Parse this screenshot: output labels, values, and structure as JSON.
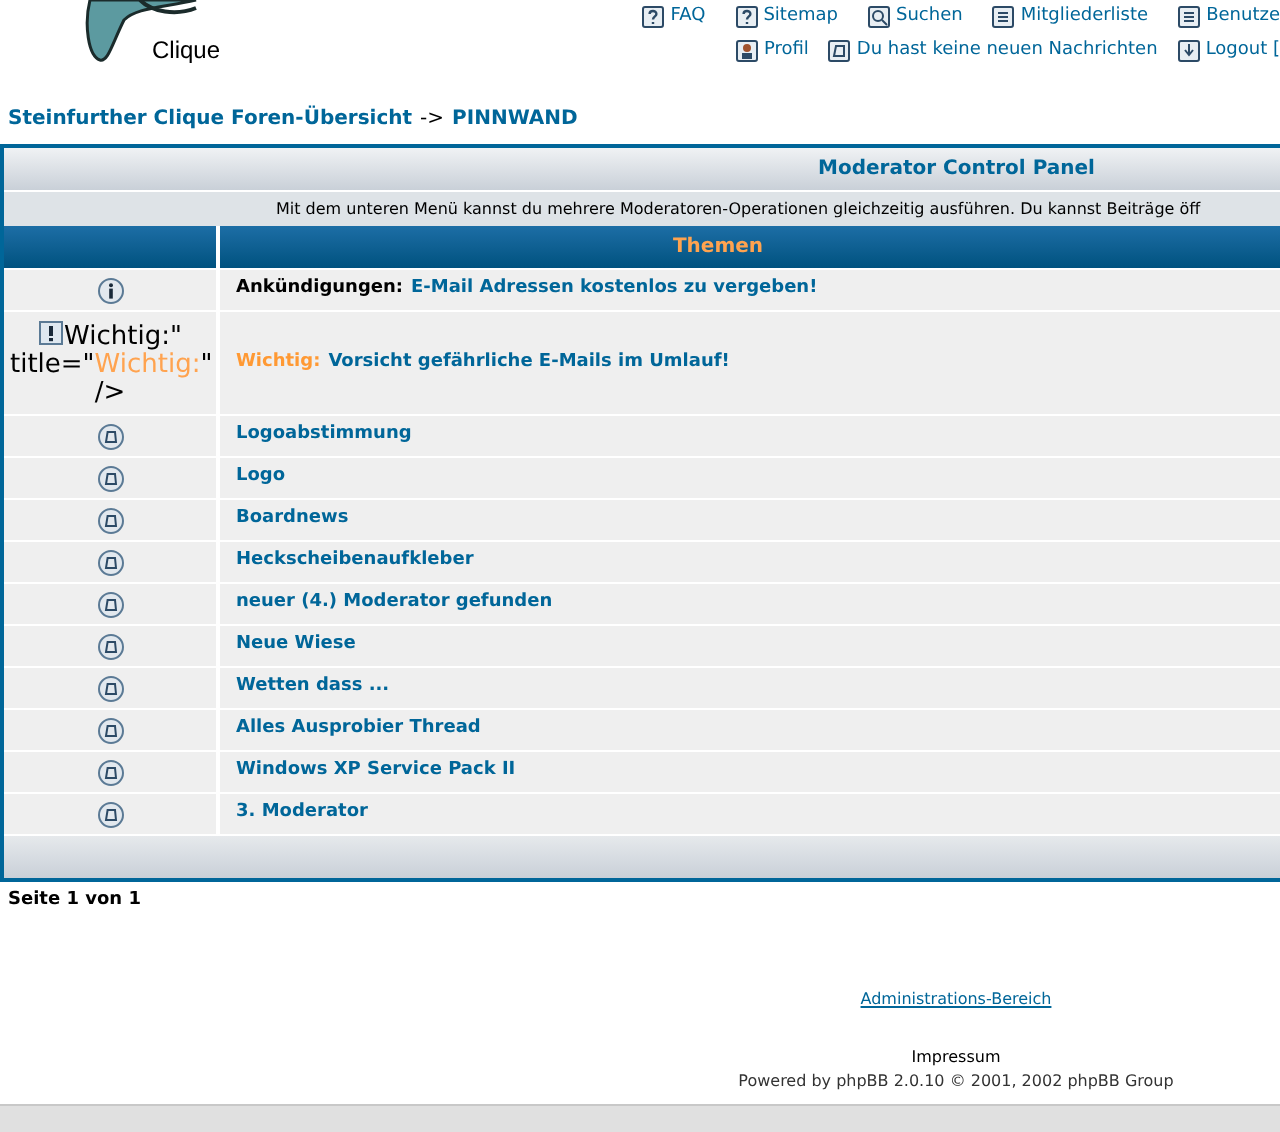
{
  "logo": {
    "text": "Clique"
  },
  "nav_top": [
    {
      "label": "FAQ"
    },
    {
      "label": "Sitemap"
    },
    {
      "label": "Suchen"
    },
    {
      "label": "Mitgliederliste"
    },
    {
      "label": "Benutze"
    }
  ],
  "nav_bottom": [
    {
      "label": "Profil"
    },
    {
      "label": "Du hast keine neuen Nachrichten"
    },
    {
      "label": "Logout ["
    }
  ],
  "breadcrumb": {
    "home": "Steinfurther Clique Foren-Übersicht",
    "separator": "->",
    "current": "PINNWAND"
  },
  "panel": {
    "title": "Moderator Control Panel",
    "description": "Mit dem unteren Menü kannst du mehrere Moderatoren-Operationen gleichzeitig ausführen. Du kannst Beiträge öff"
  },
  "table": {
    "columns": [
      "Themen"
    ],
    "rows": [
      {
        "kind": "announcement",
        "prefix": "Ankündigungen:",
        "title": "E-Mail Adressen kostenlos zu vergeben!"
      },
      {
        "kind": "sticky",
        "alt_text": [
          "Wichtig:\" title=\"",
          "Wichtig:",
          "\" />"
        ],
        "prefix": "Wichtig:",
        "title": "Vorsicht gefährliche E-Mails im Umlauf!"
      },
      {
        "kind": "normal",
        "title": "Logoabstimmung"
      },
      {
        "kind": "normal",
        "title": "Logo"
      },
      {
        "kind": "normal",
        "title": "Boardnews"
      },
      {
        "kind": "normal",
        "title": "Heckscheibenaufkleber"
      },
      {
        "kind": "normal",
        "title": "neuer (4.) Moderator gefunden"
      },
      {
        "kind": "normal",
        "title": "Neue Wiese"
      },
      {
        "kind": "normal",
        "title": "Wetten dass ..."
      },
      {
        "kind": "normal",
        "title": "Alles Ausprobier Thread"
      },
      {
        "kind": "normal",
        "title": "Windows XP Service Pack II"
      },
      {
        "kind": "normal",
        "title": "3. Moderator"
      }
    ]
  },
  "pagination": "Seite 1 von 1",
  "footer": {
    "admin_link": "Administrations-Bereich",
    "imprint": "Impressum",
    "powered_by": "Powered by phpBB 2.0.10 © 2001, 2002 phpBB Group"
  }
}
